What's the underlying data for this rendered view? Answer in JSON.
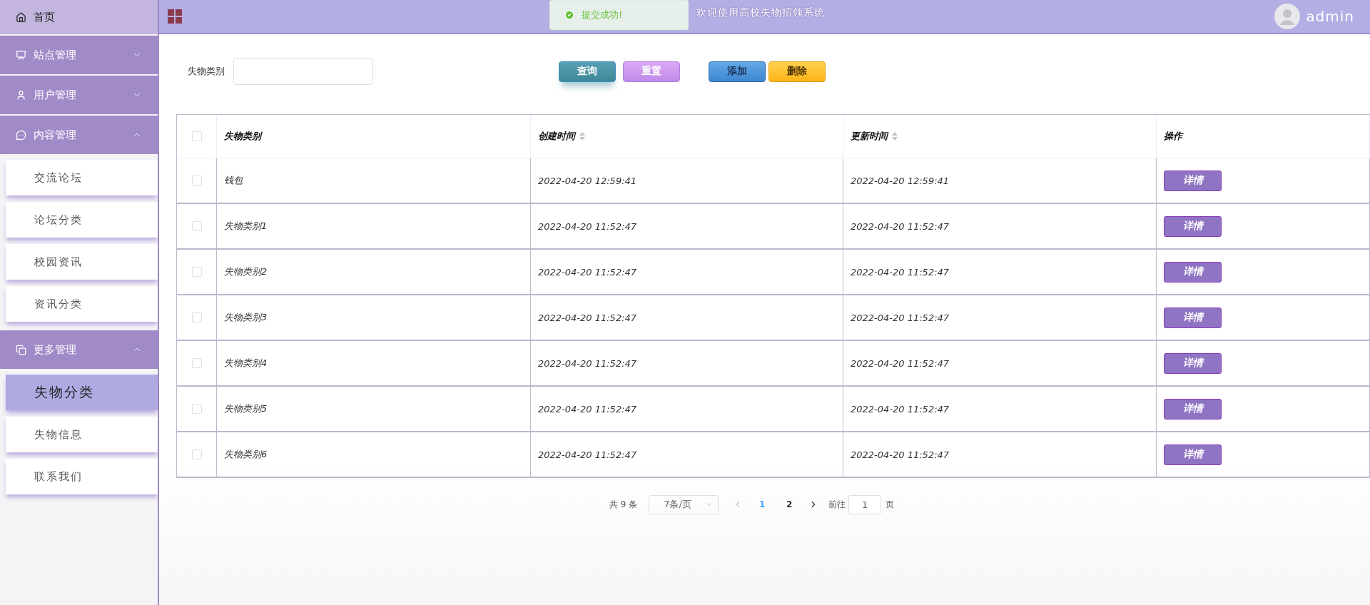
{
  "header": {
    "title": "欢迎使用高校失物招领系统",
    "user": "admin"
  },
  "toast": {
    "message": "提交成功!"
  },
  "sidebar": {
    "items": [
      {
        "label": "首页",
        "kind": "link"
      },
      {
        "label": "站点管理",
        "kind": "group",
        "expanded": false
      },
      {
        "label": "用户管理",
        "kind": "group",
        "expanded": false
      },
      {
        "label": "内容管理",
        "kind": "group",
        "expanded": true,
        "children": [
          {
            "label": "交流论坛",
            "selected": false
          },
          {
            "label": "论坛分类",
            "selected": false
          },
          {
            "label": "校园资讯",
            "selected": false
          },
          {
            "label": "资讯分类",
            "selected": false
          }
        ]
      },
      {
        "label": "更多管理",
        "kind": "group",
        "expanded": true,
        "children": [
          {
            "label": "失物分类",
            "selected": true
          },
          {
            "label": "失物信息",
            "selected": false
          },
          {
            "label": "联系我们",
            "selected": false
          }
        ]
      }
    ]
  },
  "search": {
    "label": "失物类别"
  },
  "buttons": [
    {
      "label": "查询",
      "kind": "search"
    },
    {
      "label": "重置",
      "kind": "reset"
    },
    {
      "label": "添加",
      "kind": "add"
    },
    {
      "label": "删除",
      "kind": "delete"
    }
  ],
  "table": {
    "all_checked": false,
    "columns": [
      {
        "label": "失物类别",
        "sortable": false
      },
      {
        "label": "创建时间",
        "sortable": true
      },
      {
        "label": "更新时间",
        "sortable": true
      },
      {
        "label": "操作",
        "sortable": false
      }
    ],
    "rows": [
      {
        "checked": false,
        "cells": [
          "钱包",
          "2022-04-20 12:59:41",
          "2022-04-20 12:59:41"
        ],
        "action": "详情"
      },
      {
        "checked": false,
        "cells": [
          "失物类别1",
          "2022-04-20 11:52:47",
          "2022-04-20 11:52:47"
        ],
        "action": "详情"
      },
      {
        "checked": false,
        "cells": [
          "失物类别2",
          "2022-04-20 11:52:47",
          "2022-04-20 11:52:47"
        ],
        "action": "详情"
      },
      {
        "checked": false,
        "cells": [
          "失物类别3",
          "2022-04-20 11:52:47",
          "2022-04-20 11:52:47"
        ],
        "action": "详情"
      },
      {
        "checked": false,
        "cells": [
          "失物类别4",
          "2022-04-20 11:52:47",
          "2022-04-20 11:52:47"
        ],
        "action": "详情"
      },
      {
        "checked": false,
        "cells": [
          "失物类别5",
          "2022-04-20 11:52:47",
          "2022-04-20 11:52:47"
        ],
        "action": "详情"
      },
      {
        "checked": false,
        "cells": [
          "失物类别6",
          "2022-04-20 11:52:47",
          "2022-04-20 11:52:47"
        ],
        "action": "详情"
      }
    ]
  },
  "pagination": {
    "total": "共 9 条",
    "page_size": "7条/页",
    "pages": [
      {
        "label": "1",
        "selected": true
      },
      {
        "label": "2",
        "selected": false
      }
    ],
    "goto_label": "前往",
    "goto_value": "1",
    "goto_suffix": "页"
  }
}
